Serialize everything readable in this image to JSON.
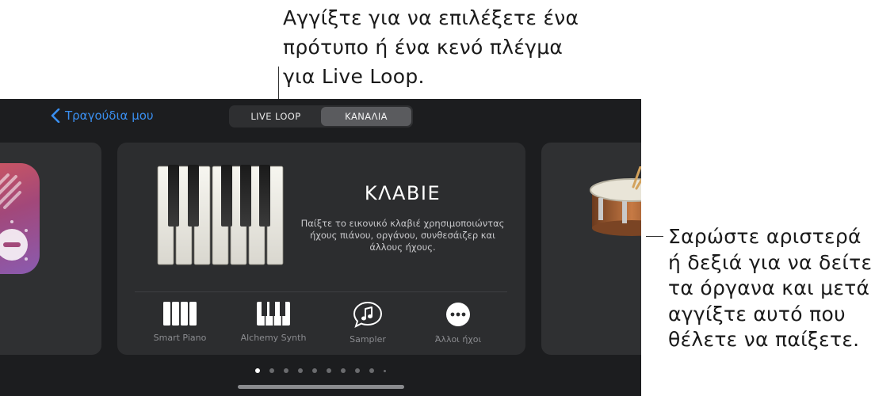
{
  "annotations": {
    "top_lines": [
      "Αγγίξτε για να επιλέξετε ένα",
      "πρότυπο ή ένα κενό πλέγμα",
      "για Live Loop."
    ],
    "right_lines": [
      "Σαρώστε αριστερά",
      "ή δεξιά για να δείτε",
      "τα όργανα και μετά",
      "αγγίξτε αυτό που",
      "θέλετε να παίξετε."
    ]
  },
  "nav": {
    "back_label": "Τραγούδια μου",
    "tabs": [
      {
        "label": "LIVE LOOP",
        "active": false
      },
      {
        "label": "ΚΑΝΑΛΙΑ",
        "active": true
      }
    ]
  },
  "main_card": {
    "title": "ΚΛΑΒΙΕ",
    "description": "Παίξτε το εικονικό κλαβιέ χρησιμοποιώντας ήχους πιάνου, οργάνου, συνθεσάιζερ και άλλους ήχους.",
    "options": [
      {
        "label": "Smart Piano",
        "icon": "smart-piano-icon"
      },
      {
        "label": "Alchemy Synth",
        "icon": "keyboard-icon"
      },
      {
        "label": "Sampler",
        "icon": "music-note-bubble-icon"
      },
      {
        "label": "Άλλοι ήχοι",
        "icon": "more-icon"
      }
    ]
  },
  "pager": {
    "count": 10,
    "active_index": 0
  },
  "colors": {
    "accent": "#3a8ff0",
    "background": "#1c1d1f",
    "card": "#2c2d2f"
  }
}
